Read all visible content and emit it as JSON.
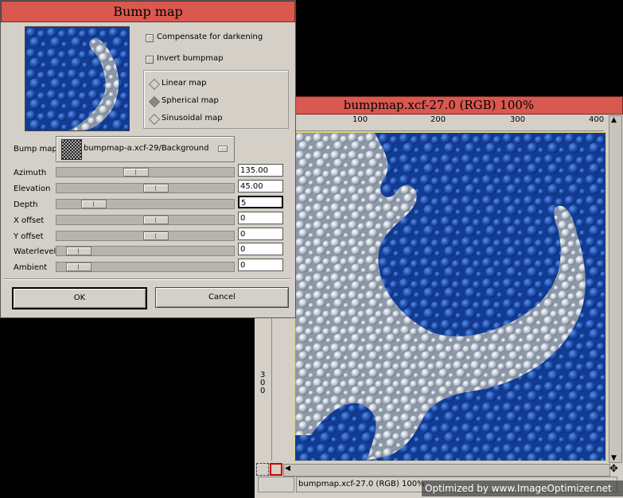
{
  "dialog": {
    "title": "Bump map",
    "compensate_label": "Compensate for darkening",
    "invert_label": "Invert bumpmap",
    "map_types": [
      "Linear map",
      "Spherical map",
      "Sinusoidal map"
    ],
    "selected_map_type": "Spherical map",
    "bump_map_label": "Bump map",
    "bump_map_value": "bumpmap-a.xcf-29/Background",
    "sliders": [
      {
        "label": "Azimuth",
        "value": "135.00",
        "level": 0.375
      },
      {
        "label": "Elevation",
        "value": "45.00",
        "level": 0.5
      },
      {
        "label": "Depth",
        "value": "5",
        "level": 0.1
      },
      {
        "label": "X offset",
        "value": "0",
        "level": 0.5
      },
      {
        "label": "Y offset",
        "value": "0",
        "level": 0.5
      },
      {
        "label": "Waterlevel",
        "value": "0",
        "level": 0.0
      },
      {
        "label": "Ambient",
        "value": "0",
        "level": 0.0
      }
    ],
    "ok_label": "OK",
    "cancel_label": "Cancel"
  },
  "image_window": {
    "title": "bumpmap.xcf-27.0 (RGB) 100%",
    "status": "bumpmap.xcf-27.0 (RGB) 100%",
    "ruler_h_labels": [
      "100",
      "200",
      "300",
      "400"
    ],
    "ruler_v_label": "300"
  },
  "watermark": "Optimized by www.ImageOptimizer.net",
  "colors": {
    "titlebar": "#d9584f",
    "canvas_blue": "#1747a6",
    "land": "#c8ccd4"
  }
}
